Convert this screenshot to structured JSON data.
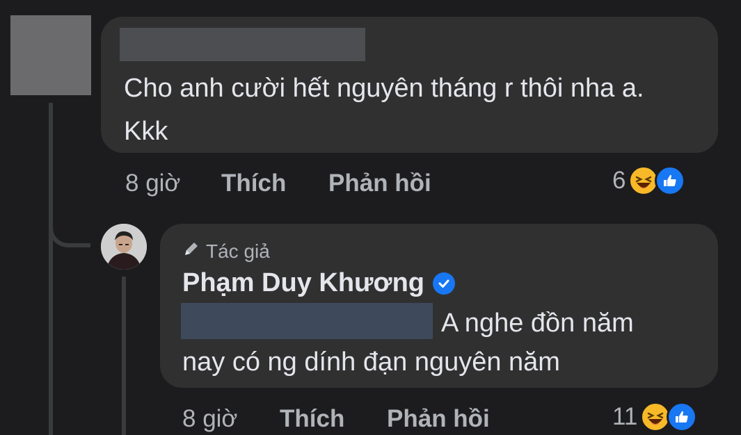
{
  "comment1": {
    "text": "Cho anh cười hết nguyên tháng r thôi nha a. Kkk",
    "time": "8 giờ",
    "like_label": "Thích",
    "reply_label": "Phản hồi",
    "reaction_count": "6",
    "reactions": [
      "haha-icon",
      "like-icon"
    ]
  },
  "reply": {
    "author_badge": "Tác giả",
    "author_name": "Phạm Duy Khương",
    "text_line1": "A nghe đồn năm",
    "text_line2": "nay có ng dính đạn nguyên năm",
    "time": "8 giờ",
    "like_label": "Thích",
    "reply_label": "Phản hồi",
    "reaction_count": "11",
    "reactions": [
      "haha-icon",
      "like-icon"
    ]
  },
  "colors": {
    "background": "#1c1c1e",
    "bubble": "#303031",
    "meta_text": "#b0b3b8",
    "like_blue": "#1877f2",
    "haha_yellow": "#f7b928"
  }
}
